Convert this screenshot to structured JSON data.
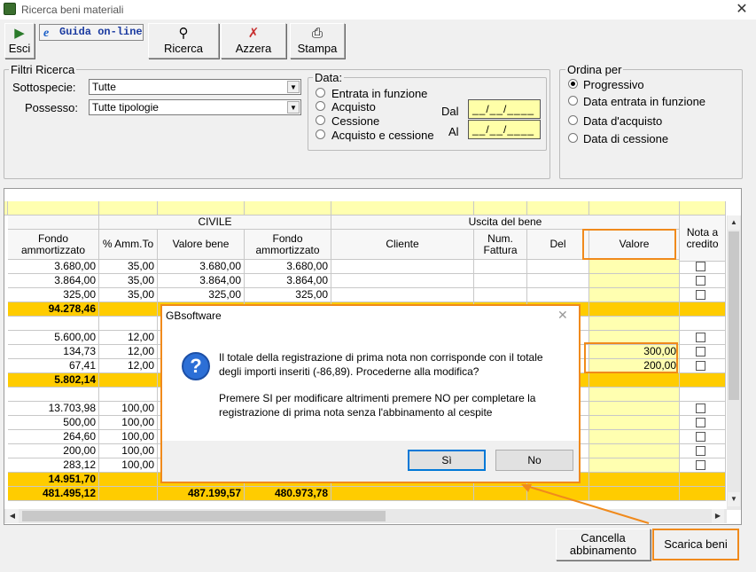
{
  "window": {
    "title": "Ricerca beni materiali",
    "close_glyph": "✕"
  },
  "toolbar": {
    "esci": "Esci",
    "guida": "Guida on-line",
    "guida_icon_glyph": "e",
    "ricerca": "Ricerca",
    "azzera": "Azzera",
    "stampa": "Stampa"
  },
  "filters": {
    "group_label": "Filtri Ricerca",
    "sottospecie_label": "Sottospecie:",
    "sottospecie_value": "Tutte",
    "possesso_label": "Possesso:",
    "possesso_value": "Tutte tipologie"
  },
  "date": {
    "group_label": "Data:",
    "options": [
      "Entrata in funzione",
      "Acquisto",
      "Cessione",
      "Acquisto e cessione"
    ],
    "dal_label": "Dal",
    "dal_value": "__/__/____",
    "al_label": "Al",
    "al_value": "__/__/____"
  },
  "order": {
    "group_label": "Ordina per",
    "options": [
      "Progressivo",
      "Data entrata in funzione",
      "Data d'acquisto",
      "Data di cessione"
    ],
    "selected_index": 0
  },
  "table": {
    "group_civile": "CIVILE",
    "group_uscita": "Uscita del bene",
    "headers": {
      "fondo": "Fondo ammortizzato",
      "amm": "% Amm.To",
      "valore_bene": "Valore bene",
      "fondo2": "Fondo ammortizzato",
      "cliente": "Cliente",
      "num_fattura": "Num. Fattura",
      "del": "Del",
      "valore": "Valore",
      "nota": "Nota a credito"
    },
    "rows": [
      {
        "fondo": "3.680,00",
        "amm": "35,00",
        "valore_bene": "3.680,00",
        "fondo2": "3.680,00",
        "valore": ""
      },
      {
        "fondo": "3.864,00",
        "amm": "35,00",
        "valore_bene": "3.864,00",
        "fondo2": "3.864,00",
        "valore": ""
      },
      {
        "fondo": "325,00",
        "amm": "35,00",
        "valore_bene": "325,00",
        "fondo2": "325,00",
        "valore": ""
      },
      {
        "fondo": "94.278,46",
        "amm": "",
        "valore_bene": "",
        "fondo2": "",
        "valore": "",
        "subtotal": true
      },
      {
        "fondo": "",
        "amm": "",
        "valore_bene": "",
        "fondo2": "",
        "valore": ""
      },
      {
        "fondo": "5.600,00",
        "amm": "12,00",
        "valore_bene": "",
        "fondo2": "",
        "valore": ""
      },
      {
        "fondo": "134,73",
        "amm": "12,00",
        "valore_bene": "",
        "fondo2": "",
        "valore": "300,00"
      },
      {
        "fondo": "67,41",
        "amm": "12,00",
        "valore_bene": "",
        "fondo2": "",
        "valore": "200,00"
      },
      {
        "fondo": "5.802,14",
        "amm": "",
        "valore_bene": "",
        "fondo2": "",
        "valore": "",
        "subtotal": true
      },
      {
        "fondo": "",
        "amm": "",
        "valore_bene": "",
        "fondo2": "",
        "valore": ""
      },
      {
        "fondo": "13.703,98",
        "amm": "100,00",
        "valore_bene": "",
        "fondo2": "",
        "valore": ""
      },
      {
        "fondo": "500,00",
        "amm": "100,00",
        "valore_bene": "",
        "fondo2": "",
        "valore": ""
      },
      {
        "fondo": "264,60",
        "amm": "100,00",
        "valore_bene": "",
        "fondo2": "",
        "valore": ""
      },
      {
        "fondo": "200,00",
        "amm": "100,00",
        "valore_bene": "",
        "fondo2": "",
        "valore": ""
      },
      {
        "fondo": "283,12",
        "amm": "100,00",
        "valore_bene": "",
        "fondo2": "",
        "valore": ""
      },
      {
        "fondo": "14.951,70",
        "amm": "",
        "valore_bene": "",
        "fondo2": "",
        "valore": "",
        "subtotal": true
      },
      {
        "fondo": "481.495,12",
        "amm": "",
        "valore_bene": "487.199,57",
        "fondo2": "480.973,78",
        "valore": "",
        "subtotal": true
      }
    ]
  },
  "dialog": {
    "title": "GBsoftware",
    "close_glyph": "✕",
    "icon_glyph": "?",
    "line1": "Il totale della registrazione di prima nota non corrisponde con il totale",
    "line2": "degli importi inseriti (-86,89). Procederne alla modifica?",
    "line3": "Premere SI per modificare altrimenti premere NO per completare la",
    "line4": "registrazione di prima nota senza l'abbinamento al cespite",
    "yes": "Sì",
    "no": "No"
  },
  "bottom": {
    "cancella1": "Cancella",
    "cancella2": "abbinamento",
    "scarica": "Scarica beni"
  },
  "colors": {
    "highlight": "#f08a1c",
    "yellow": "#ffffb0",
    "gold": "#ffcc00"
  }
}
